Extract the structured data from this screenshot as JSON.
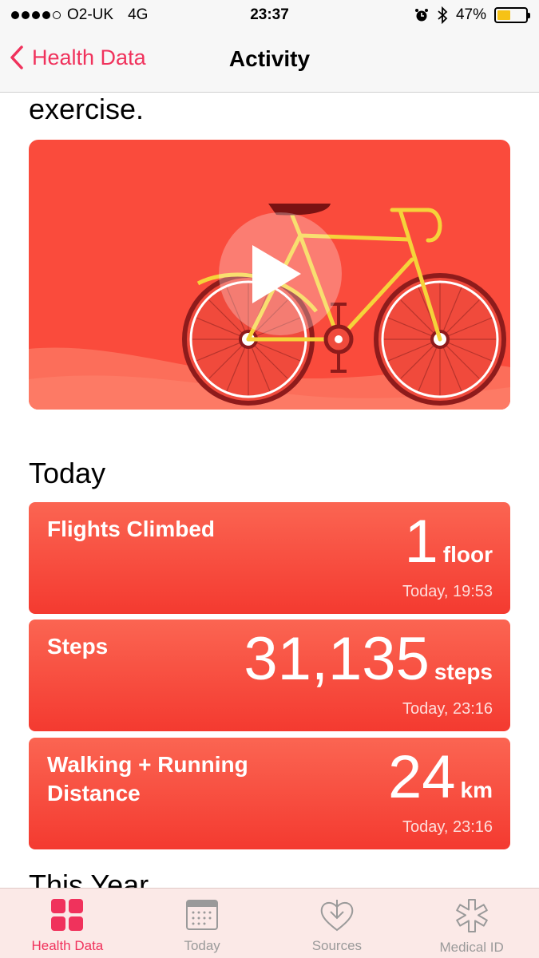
{
  "status_bar": {
    "carrier": "O2-UK",
    "network": "4G",
    "time": "23:37",
    "battery_percent": "47%",
    "battery_level": 0.47,
    "icons": [
      "signal-dots",
      "alarm-icon",
      "bluetooth-icon",
      "battery-icon"
    ]
  },
  "nav": {
    "back_label": "Health Data",
    "title": "Activity"
  },
  "intro_text_tail": "exercise.",
  "video": {
    "icon": "play-icon",
    "illustration": "bicycle"
  },
  "sections": {
    "today": "Today",
    "this_year": "This Year"
  },
  "metrics": [
    {
      "label": "Flights Climbed",
      "value": "1",
      "unit": "floor",
      "time": "Today, 19:53"
    },
    {
      "label": "Steps",
      "value": "31,135",
      "unit": "steps",
      "time": "Today, 23:16"
    },
    {
      "label": "Walking + Running Distance",
      "value": "24",
      "unit": "km",
      "time": "Today, 23:16"
    }
  ],
  "tabs": [
    {
      "label": "Health Data",
      "icon": "grid-icon",
      "active": true
    },
    {
      "label": "Today",
      "icon": "calendar-icon",
      "active": false
    },
    {
      "label": "Sources",
      "icon": "heart-download-icon",
      "active": false
    },
    {
      "label": "Medical ID",
      "icon": "asterisk-icon",
      "active": false
    }
  ],
  "colors": {
    "accent": "#f0325c",
    "card_top": "#fb6552",
    "card_bottom": "#f43a30",
    "video_bg": "#fa4b3c",
    "battery_fill": "#f6c216",
    "bike_frame": "#f5d33a"
  }
}
